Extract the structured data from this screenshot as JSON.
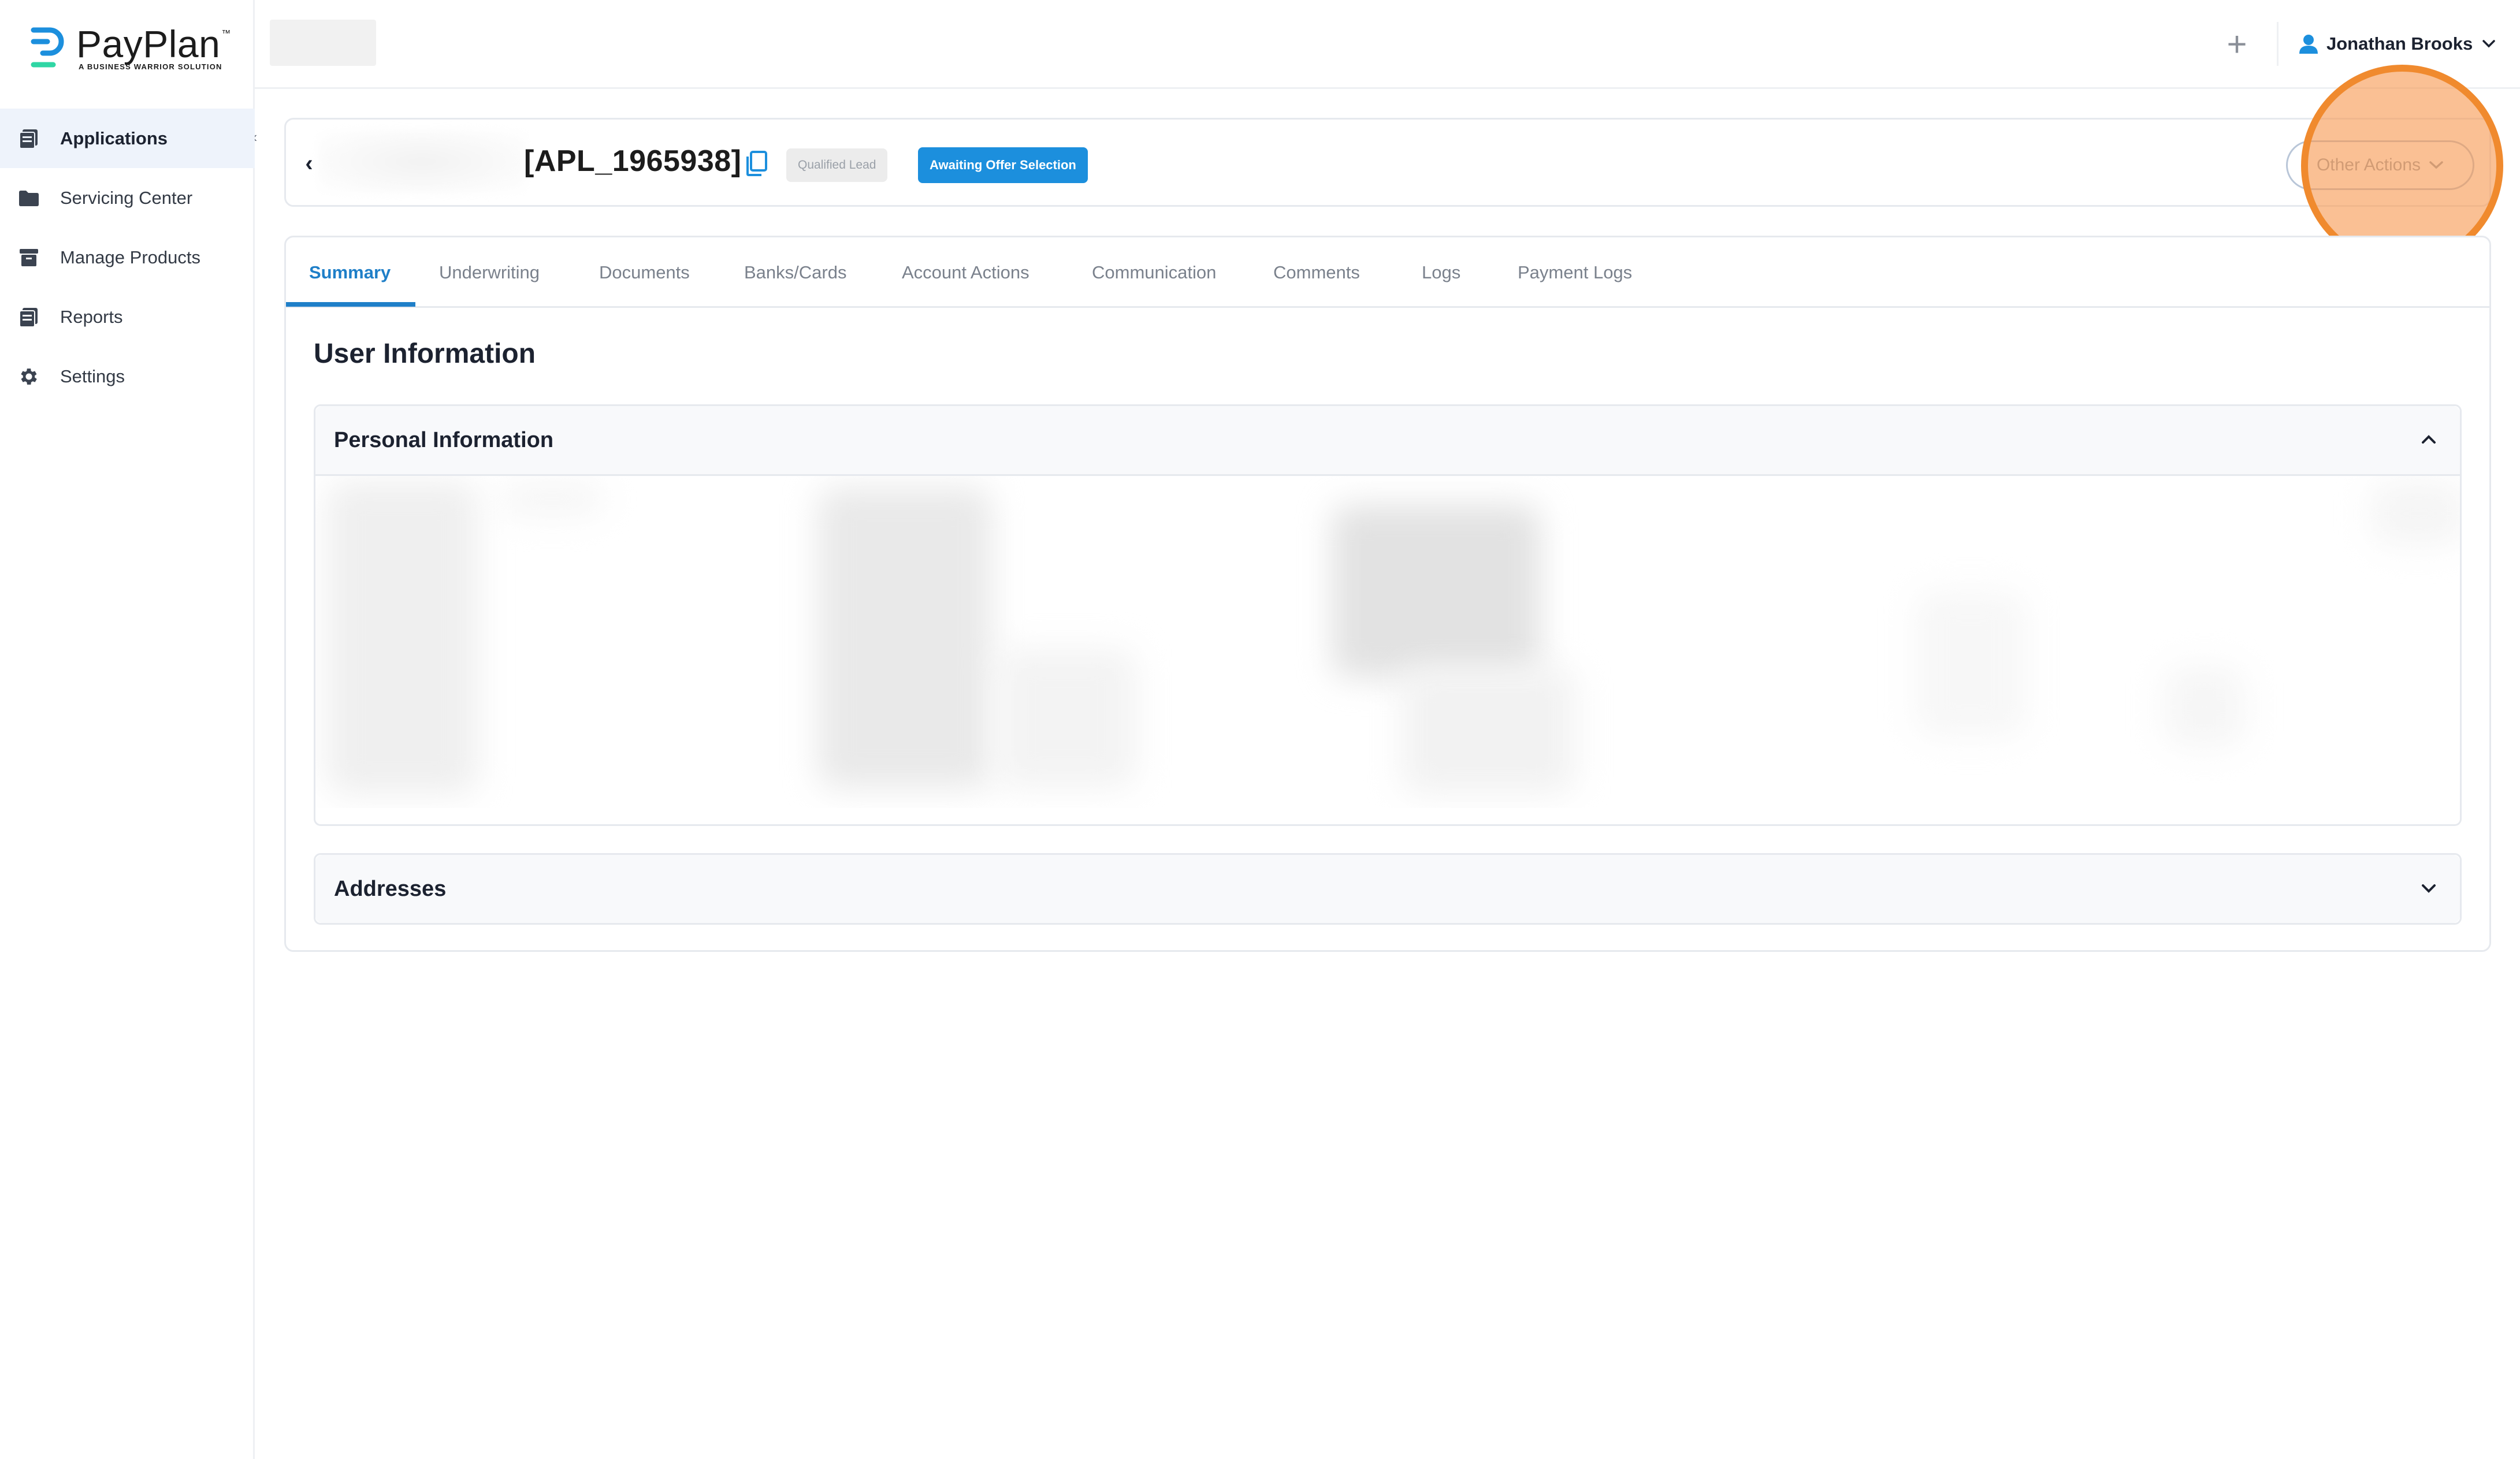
{
  "brand": {
    "name": "PayPlan",
    "trademark": "™",
    "tagline": "A BUSINESS WARRIOR SOLUTION",
    "accent_color": "#1f7fc8",
    "logo_colors": [
      "#1c8fdd",
      "#2fd6a4"
    ]
  },
  "sidebar": {
    "items": [
      {
        "label": "Applications",
        "icon": "applications-icon",
        "active": true
      },
      {
        "label": "Servicing Center",
        "icon": "folder-icon",
        "active": false
      },
      {
        "label": "Manage Products",
        "icon": "archive-box-icon",
        "active": false
      },
      {
        "label": "Reports",
        "icon": "reports-icon",
        "active": false
      },
      {
        "label": "Settings",
        "icon": "gear-icon",
        "active": false
      }
    ]
  },
  "topbar": {
    "user_name": "Jonathan Brooks"
  },
  "header": {
    "application_id": "[APL_1965938]",
    "lead_badge": "Qualified Lead",
    "status_badge": "Awaiting Offer Selection",
    "status_color": "#1c8fdd",
    "other_actions_label": "Other Actions"
  },
  "tabs": [
    {
      "label": "Summary",
      "active": true
    },
    {
      "label": "Underwriting",
      "active": false
    },
    {
      "label": "Documents",
      "active": false
    },
    {
      "label": "Banks/Cards",
      "active": false
    },
    {
      "label": "Account Actions",
      "active": false
    },
    {
      "label": "Communication",
      "active": false
    },
    {
      "label": "Comments",
      "active": false
    },
    {
      "label": "Logs",
      "active": false
    },
    {
      "label": "Payment Logs",
      "active": false
    }
  ],
  "main": {
    "section_title": "User Information",
    "personal_info_title": "Personal Information",
    "personal_info_expanded": true,
    "addresses_title": "Addresses",
    "addresses_expanded": false
  },
  "highlight_color": "#f08a2e"
}
